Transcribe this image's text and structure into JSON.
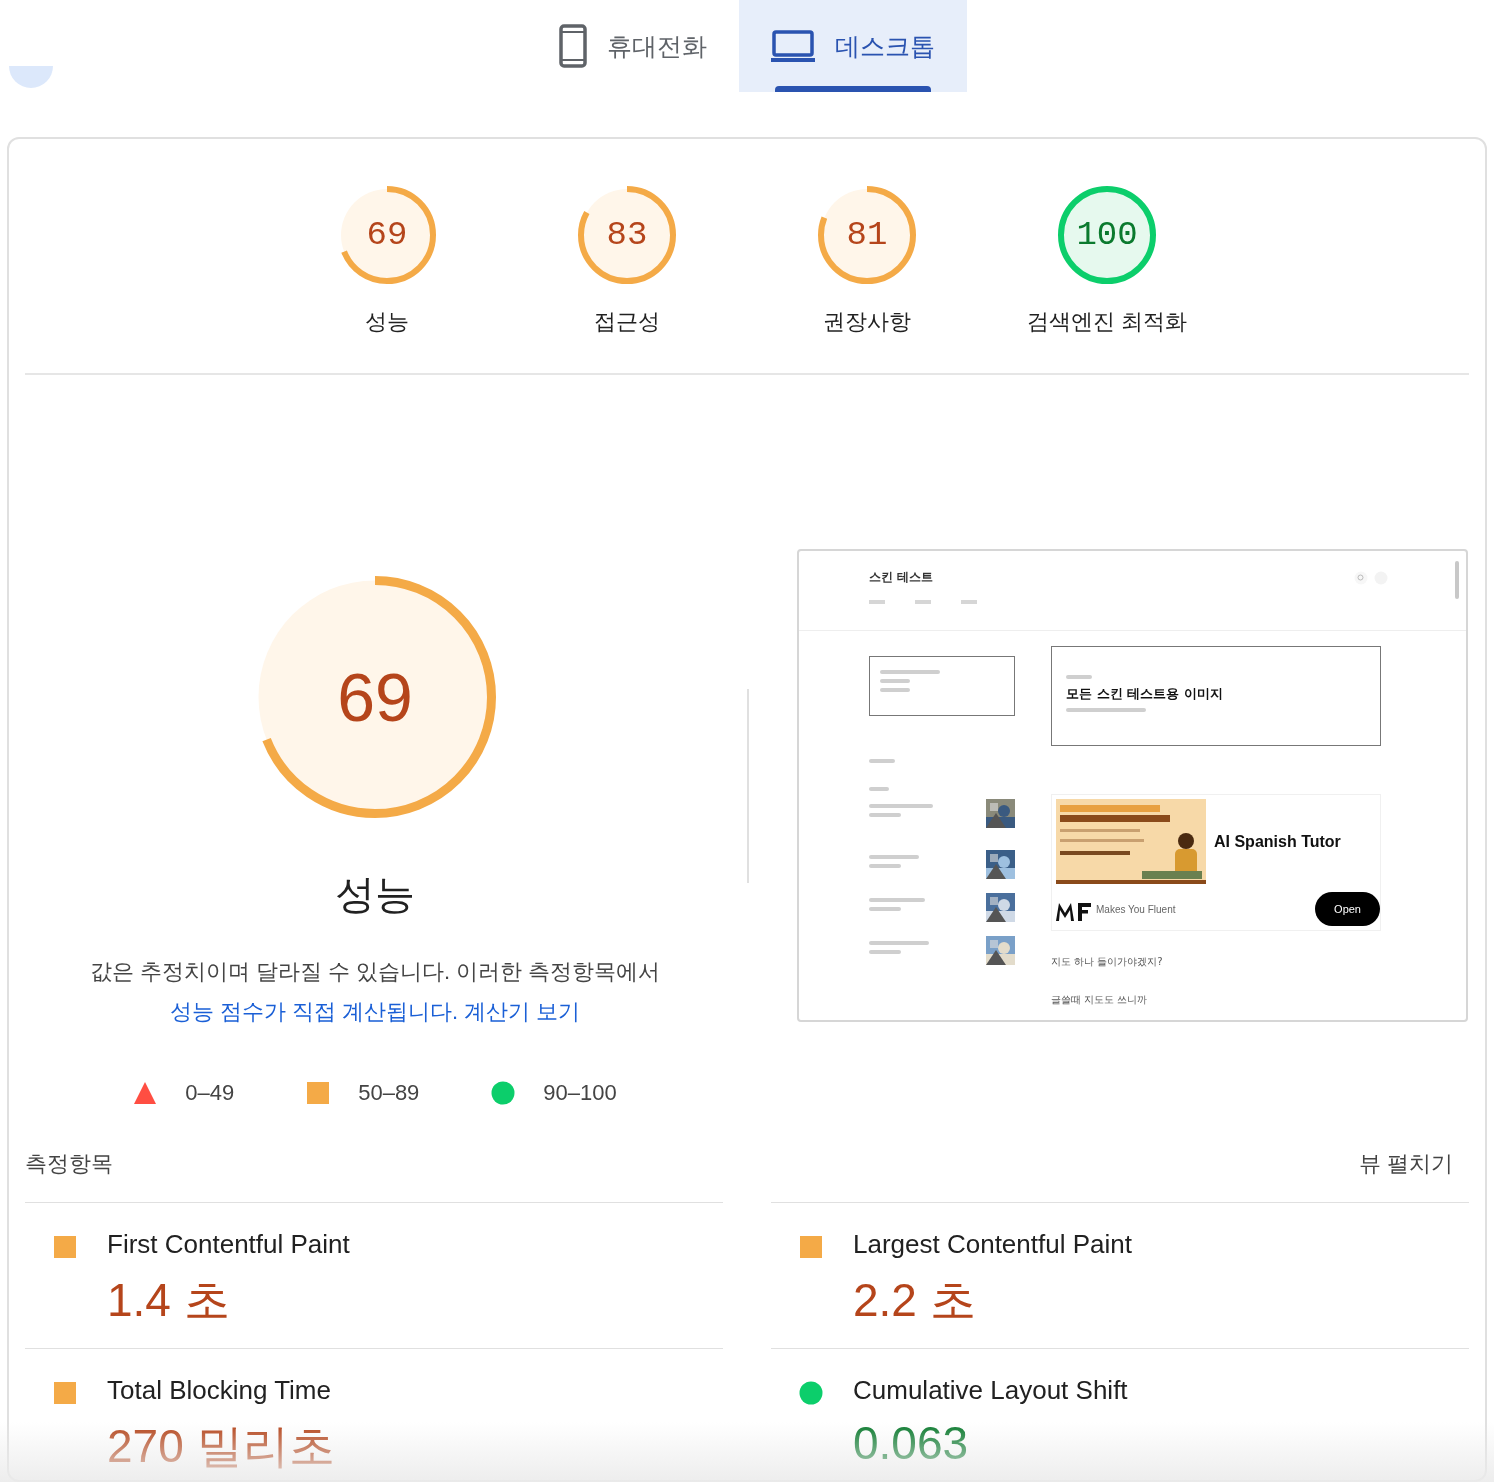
{
  "tabs": [
    {
      "label": "휴대전화",
      "kind": "mobile",
      "selected": false
    },
    {
      "label": "데스크톱",
      "kind": "desktop",
      "selected": true
    }
  ],
  "gauges": [
    {
      "score": "69",
      "label": "성능",
      "level": 0.69,
      "kind": "average"
    },
    {
      "score": "83",
      "label": "접근성",
      "level": 0.83,
      "kind": "average"
    },
    {
      "score": "81",
      "label": "권장사항",
      "level": 0.81,
      "kind": "average"
    },
    {
      "score": "100",
      "label": "검색엔진 최적화",
      "level": 1,
      "kind": "pass"
    }
  ],
  "performance": {
    "score": "69",
    "level": 0.69,
    "kind": "average",
    "title": "성능",
    "description": {
      "text": "값은 추정치이며 달라질 수 있습니다. 이러한 측정항목에서 ",
      "links": [
        "성능 점수가 직접 계산됩니다.",
        "계산기 보기"
      ]
    },
    "legend": [
      {
        "kind": "fail",
        "range": "0–49"
      },
      {
        "kind": "average",
        "range": "50–89"
      },
      {
        "kind": "pass",
        "range": "90–100"
      }
    ]
  },
  "screenshot": {
    "site_title": "스킨 테스트",
    "post_title": "모든 스킨 테스트용 이미지",
    "ad_title": "AI Spanish Tutor",
    "ad_tagline": "Makes You Fluent",
    "ad_button": "Open",
    "lines": [
      "지도 하나 들이가야겠지?",
      "글쓸때 지도도 쓰니까"
    ]
  },
  "metrics": {
    "title": "측정항목",
    "toggle": "뷰 펼치기",
    "items": [
      {
        "name": "First Contentful Paint",
        "value": "1.4 초",
        "kind": "average"
      },
      {
        "name": "Largest Contentful Paint",
        "value": "2.2 초",
        "kind": "average"
      },
      {
        "name": "Total Blocking Time",
        "value": "270 밀리초",
        "kind": "average"
      },
      {
        "name": "Cumulative Layout Shift",
        "value": "0.063",
        "kind": "pass"
      }
    ]
  }
}
